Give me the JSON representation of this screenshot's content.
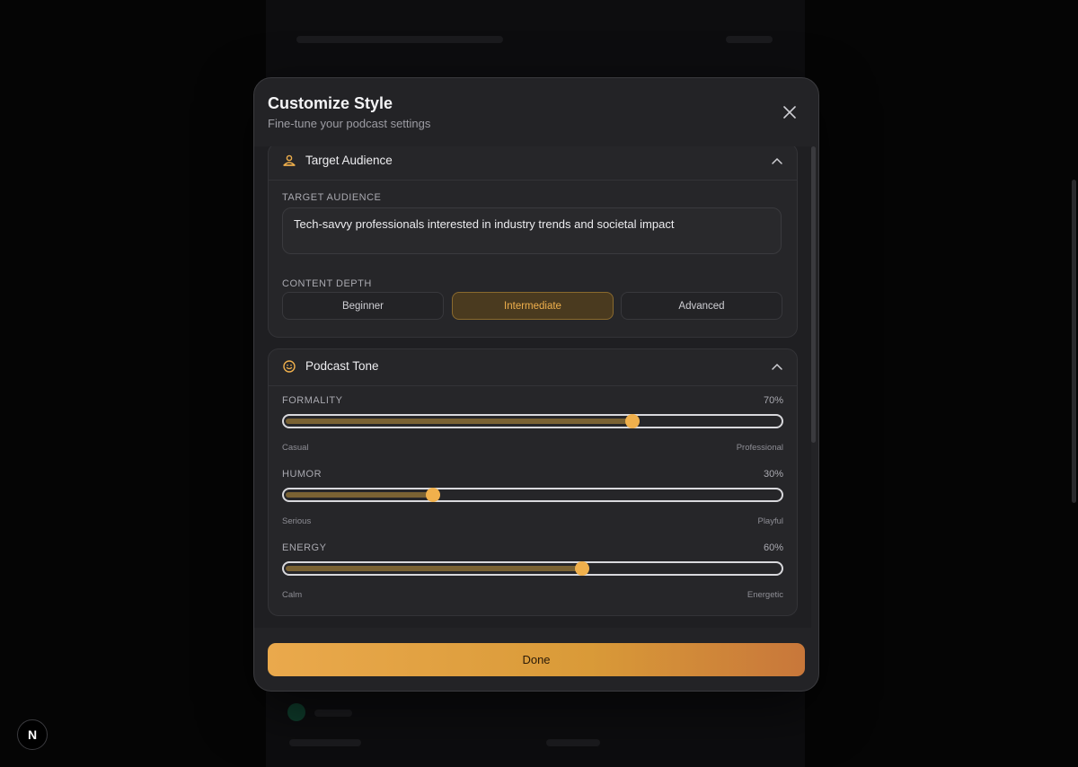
{
  "modal": {
    "title": "Customize Style",
    "subtitle": "Fine-tune your podcast settings",
    "done_label": "Done"
  },
  "target_audience": {
    "section_title": "Target Audience",
    "field_label": "TARGET AUDIENCE",
    "value": "Tech-savvy professionals interested in industry trends and societal impact",
    "depth_label": "CONTENT DEPTH",
    "depth_options": [
      "Beginner",
      "Intermediate",
      "Advanced"
    ],
    "depth_selected": "Intermediate"
  },
  "podcast_tone": {
    "section_title": "Podcast Tone",
    "sliders": [
      {
        "label": "FORMALITY",
        "value_text": "70%",
        "value": 0.7,
        "min_label": "Casual",
        "max_label": "Professional"
      },
      {
        "label": "HUMOR",
        "value_text": "30%",
        "value": 0.3,
        "min_label": "Serious",
        "max_label": "Playful"
      },
      {
        "label": "ENERGY",
        "value_text": "60%",
        "value": 0.6,
        "min_label": "Calm",
        "max_label": "Energetic"
      }
    ]
  },
  "badge": {
    "letter": "N"
  },
  "colors": {
    "accent": "#f0b04c",
    "background": "#050505",
    "modal": "#232326"
  },
  "icons": {
    "close": "close-icon",
    "audience": "users-icon",
    "tone": "smile-icon",
    "collapse": "chevron-up-icon"
  }
}
